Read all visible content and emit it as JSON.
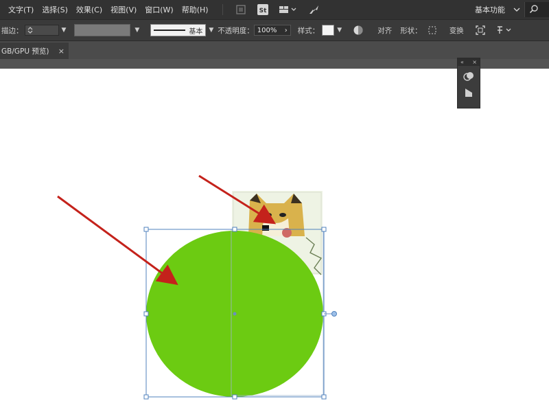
{
  "menu": {
    "items": [
      "文字(T)",
      "选择(S)",
      "效果(C)",
      "视图(V)",
      "窗口(W)",
      "帮助(H)"
    ],
    "workspace_label": "基本功能",
    "workspace_chevron": "chevron-down-icon",
    "search_icon": "search-icon"
  },
  "control_bar": {
    "stroke_label": "描边：",
    "stroke_profile_label": "基本",
    "opacity_label": "不透明度：",
    "opacity_value": "100%",
    "style_label": "样式：",
    "align_label": "对齐",
    "shape_label": "形状：",
    "transform_label": "变换"
  },
  "document_tab": {
    "title": "GB/GPU 预览)",
    "close": "×"
  },
  "colors": {
    "circle_fill": "#6ccb12",
    "arrow": "#c4221b",
    "selection": "#4f81bd",
    "menubar_bg": "#323232",
    "controlbar_bg": "#3a3a3a"
  }
}
